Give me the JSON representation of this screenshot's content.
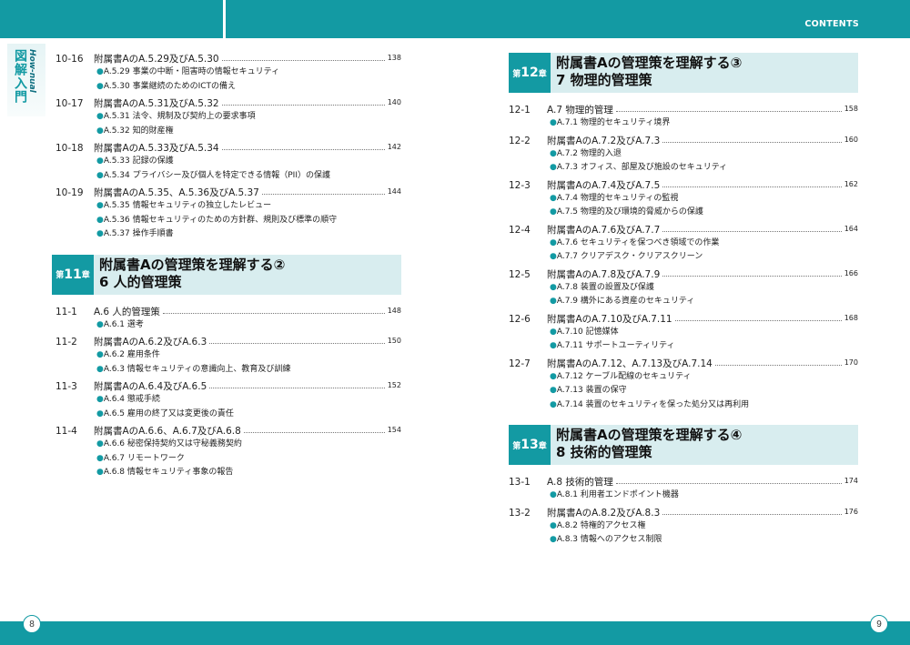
{
  "header": {
    "contents_label": "CONTENTS"
  },
  "logo": {
    "series": "How-nual",
    "name": "図解入門"
  },
  "page_numbers": {
    "left": "8",
    "right": "9"
  },
  "left_sections": [
    {
      "num": "10-16",
      "title": "附属書AのA.5.29及びA.5.30",
      "page": "138",
      "subs": [
        "A.5.29 事業の中断・阻害時の情報セキュリティ",
        "A.5.30 事業継続のためのICTの備え"
      ]
    },
    {
      "num": "10-17",
      "title": "附属書AのA.5.31及びA.5.32",
      "page": "140",
      "subs": [
        "A.5.31 法令、規制及び契約上の要求事項",
        "A.5.32 知的財産権"
      ]
    },
    {
      "num": "10-18",
      "title": "附属書AのA.5.33及びA.5.34",
      "page": "142",
      "subs": [
        "A.5.33 記録の保護",
        "A.5.34 プライバシー及び個人を特定できる情報（PII）の保護"
      ]
    },
    {
      "num": "10-19",
      "title": "附属書AのA.5.35、A.5.36及びA.5.37",
      "page": "144",
      "subs": [
        "A.5.35 情報セキュリティの独立したレビュー",
        "A.5.36 情報セキュリティのための方針群、規則及び標準の順守",
        "A.5.37 操作手順書"
      ]
    }
  ],
  "chapter11": {
    "prefix": "第",
    "number": "11",
    "suffix": "章",
    "line1": "附属書Aの管理策を理解する②",
    "line2": "6 人的管理策"
  },
  "ch11_sections": [
    {
      "num": "11-1",
      "title": "A.6 人的管理策",
      "page": "148",
      "subs": [
        "A.6.1 選考"
      ]
    },
    {
      "num": "11-2",
      "title": "附属書AのA.6.2及びA.6.3",
      "page": "150",
      "subs": [
        "A.6.2 雇用条件",
        "A.6.3 情報セキュリティの意識向上、教育及び訓練"
      ]
    },
    {
      "num": "11-3",
      "title": "附属書AのA.6.4及びA.6.5",
      "page": "152",
      "subs": [
        "A.6.4 懲戒手続",
        "A.6.5 雇用の終了又は変更後の責任"
      ]
    },
    {
      "num": "11-4",
      "title": "附属書AのA.6.6、A.6.7及びA.6.8",
      "page": "154",
      "subs": [
        "A.6.6 秘密保持契約又は守秘義務契約",
        "A.6.7 リモートワーク",
        "A.6.8 情報セキュリティ事象の報告"
      ]
    }
  ],
  "chapter12": {
    "prefix": "第",
    "number": "12",
    "suffix": "章",
    "line1": "附属書Aの管理策を理解する③",
    "line2": "7 物理的管理策"
  },
  "ch12_sections": [
    {
      "num": "12-1",
      "title": "A.7 物理的管理",
      "page": "158",
      "subs": [
        "A.7.1 物理的セキュリティ境界"
      ]
    },
    {
      "num": "12-2",
      "title": "附属書AのA.7.2及びA.7.3",
      "page": "160",
      "subs": [
        "A.7.2 物理的入退",
        "A.7.3 オフィス、部屋及び施設のセキュリティ"
      ]
    },
    {
      "num": "12-3",
      "title": "附属書AのA.7.4及びA.7.5",
      "page": "162",
      "subs": [
        "A.7.4 物理的セキュリティの監視",
        "A.7.5 物理的及び環境的脅威からの保護"
      ]
    },
    {
      "num": "12-4",
      "title": "附属書AのA.7.6及びA.7.7",
      "page": "164",
      "subs": [
        "A.7.6 セキュリティを保つべき領域での作業",
        "A.7.7 クリアデスク・クリアスクリーン"
      ]
    },
    {
      "num": "12-5",
      "title": "附属書AのA.7.8及びA.7.9",
      "page": "166",
      "subs": [
        "A.7.8 装置の設置及び保護",
        "A.7.9 構外にある資産のセキュリティ"
      ]
    },
    {
      "num": "12-6",
      "title": "附属書AのA.7.10及びA.7.11",
      "page": "168",
      "subs": [
        "A.7.10 記憶媒体",
        "A.7.11 サポートユーティリティ"
      ]
    },
    {
      "num": "12-7",
      "title": "附属書AのA.7.12、A.7.13及びA.7.14",
      "page": "170",
      "subs": [
        "A.7.12 ケーブル配線のセキュリティ",
        "A.7.13 装置の保守",
        "A.7.14 装置のセキュリティを保った処分又は再利用"
      ]
    }
  ],
  "chapter13": {
    "prefix": "第",
    "number": "13",
    "suffix": "章",
    "line1": "附属書Aの管理策を理解する④",
    "line2": "8 技術的管理策"
  },
  "ch13_sections": [
    {
      "num": "13-1",
      "title": "A.8 技術的管理",
      "page": "174",
      "subs": [
        "A.8.1 利用者エンドポイント機器"
      ]
    },
    {
      "num": "13-2",
      "title": "附属書AのA.8.2及びA.8.3",
      "page": "176",
      "subs": [
        "A.8.2 特権的アクセス権",
        "A.8.3 情報へのアクセス制限"
      ]
    }
  ]
}
